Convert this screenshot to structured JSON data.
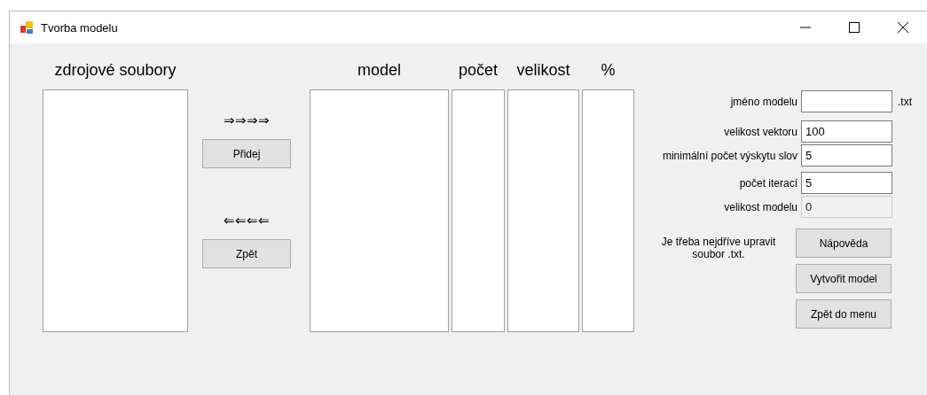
{
  "window": {
    "title": "Tvorba modelu"
  },
  "source": {
    "label": "zdrojové soubory"
  },
  "transfer": {
    "add_arrows": "⇒⇒⇒⇒",
    "add_button": "Přidej",
    "remove_arrows": "⇐⇐⇐⇐",
    "remove_button": "Zpět"
  },
  "model_columns": [
    {
      "label": "model"
    },
    {
      "label": "počet"
    },
    {
      "label": "velikost"
    },
    {
      "label": "%"
    }
  ],
  "fields": [
    {
      "label": "jméno modelu",
      "suffix": ".txt",
      "disabled": false
    },
    {
      "label": "velikost vektoru",
      "value": "100",
      "disabled": false
    },
    {
      "label": "minimální počet výskytu slov",
      "value": "5",
      "disabled": false
    },
    {
      "label": "počet iterací",
      "value": "5",
      "disabled": false
    },
    {
      "label": "velikost modelu",
      "value": "0",
      "disabled": true
    }
  ],
  "note": "Je třeba nejdříve upravit soubor .txt.",
  "buttons": [
    "Nápověda",
    "Vytvořit model",
    "Zpět do menu"
  ]
}
